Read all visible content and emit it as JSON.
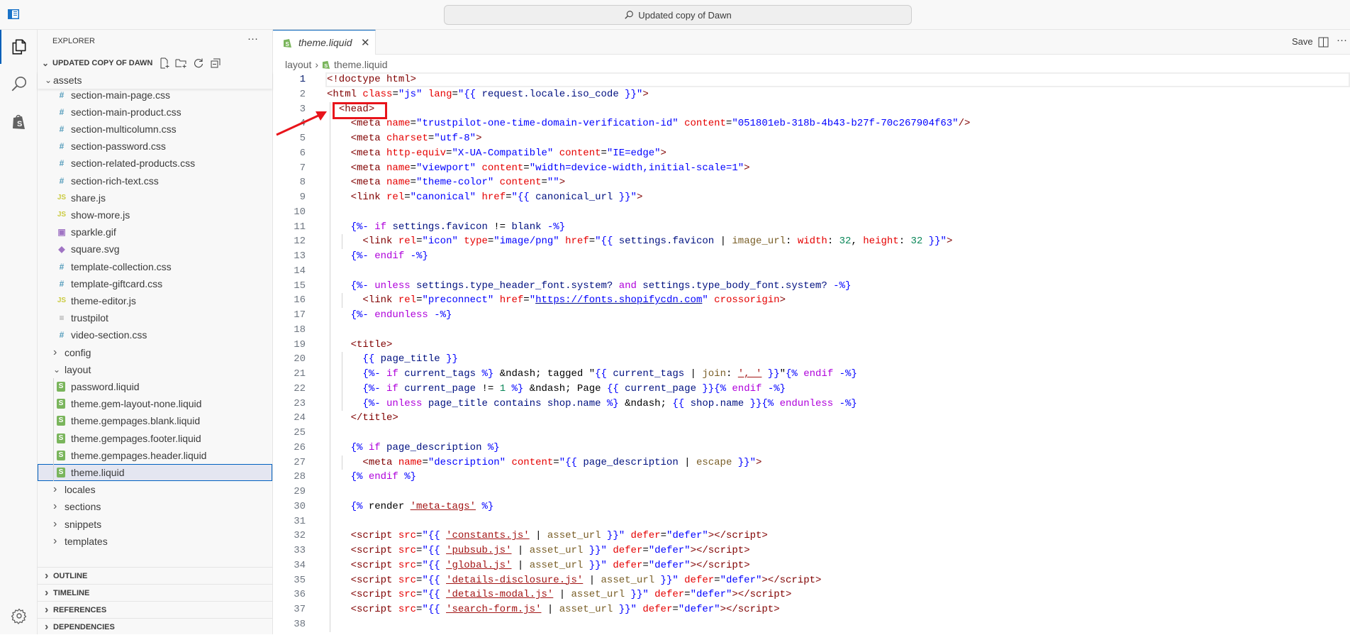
{
  "titlebar": {
    "search_text": "Updated copy of Dawn"
  },
  "activity": {
    "items": [
      "explorer",
      "search",
      "shopify"
    ],
    "settings": "settings"
  },
  "sidebar": {
    "title": "EXPLORER",
    "more": "···",
    "root": "UPDATED COPY OF DAWN",
    "assets_folder": "assets",
    "rows": [
      {
        "name": "section-main-page.css",
        "type": "css",
        "depth": 1
      },
      {
        "name": "section-main-product.css",
        "type": "css",
        "depth": 1
      },
      {
        "name": "section-multicolumn.css",
        "type": "css",
        "depth": 1
      },
      {
        "name": "section-password.css",
        "type": "css",
        "depth": 1
      },
      {
        "name": "section-related-products.css",
        "type": "css",
        "depth": 1
      },
      {
        "name": "section-rich-text.css",
        "type": "css",
        "depth": 1
      },
      {
        "name": "share.js",
        "type": "js",
        "depth": 1
      },
      {
        "name": "show-more.js",
        "type": "js",
        "depth": 1
      },
      {
        "name": "sparkle.gif",
        "type": "image",
        "depth": 1
      },
      {
        "name": "square.svg",
        "type": "svg",
        "depth": 1
      },
      {
        "name": "template-collection.css",
        "type": "css",
        "depth": 1
      },
      {
        "name": "template-giftcard.css",
        "type": "css",
        "depth": 1
      },
      {
        "name": "theme-editor.js",
        "type": "js",
        "depth": 1
      },
      {
        "name": "trustpilot",
        "type": "text",
        "depth": 1
      },
      {
        "name": "video-section.css",
        "type": "css",
        "depth": 1
      },
      {
        "name": "config",
        "type": "folder-closed",
        "depth": 0
      },
      {
        "name": "layout",
        "type": "folder-open",
        "depth": 0
      },
      {
        "name": "password.liquid",
        "type": "liquid",
        "depth": 1
      },
      {
        "name": "theme.gem-layout-none.liquid",
        "type": "liquid",
        "depth": 1
      },
      {
        "name": "theme.gempages.blank.liquid",
        "type": "liquid",
        "depth": 1
      },
      {
        "name": "theme.gempages.footer.liquid",
        "type": "liquid",
        "depth": 1
      },
      {
        "name": "theme.gempages.header.liquid",
        "type": "liquid",
        "depth": 1
      },
      {
        "name": "theme.liquid",
        "type": "liquid",
        "depth": 1,
        "selected": true
      },
      {
        "name": "locales",
        "type": "folder-closed",
        "depth": 0
      },
      {
        "name": "sections",
        "type": "folder-closed",
        "depth": 0
      },
      {
        "name": "snippets",
        "type": "folder-closed",
        "depth": 0
      },
      {
        "name": "templates",
        "type": "folder-closed",
        "depth": 0
      }
    ],
    "panels": [
      "OUTLINE",
      "TIMELINE",
      "REFERENCES",
      "DEPENDENCIES"
    ]
  },
  "editor": {
    "tab_label": "theme.liquid",
    "save_label": "Save",
    "breadcrumb": [
      "layout",
      "theme.liquid"
    ],
    "current_line": 1,
    "annotation_target": "<head>",
    "colors": {
      "tag": "#800000",
      "attr": "#e50000",
      "string": "#0000ff",
      "keyword": "#af00db",
      "variable": "#001080",
      "accent": "#005fb8",
      "annotation": "#e8141b"
    },
    "lines": [
      [
        [
          "t",
          "<!doctype html>"
        ]
      ],
      [
        [
          "t",
          "<html "
        ],
        [
          "a",
          "class"
        ],
        [
          "p",
          "="
        ],
        [
          "s",
          "\"js\" "
        ],
        [
          "a",
          "lang"
        ],
        [
          "p",
          "="
        ],
        [
          "s",
          "\"{{ "
        ],
        [
          "v",
          "request.locale.iso_code"
        ],
        [
          "s",
          " }}\""
        ],
        [
          "t",
          ">"
        ]
      ],
      [
        [
          "p",
          "  "
        ],
        [
          "t",
          "<head>"
        ]
      ],
      [
        [
          "p",
          "    "
        ],
        [
          "t",
          "<meta "
        ],
        [
          "a",
          "name"
        ],
        [
          "p",
          "="
        ],
        [
          "s",
          "\"trustpilot-one-time-domain-verification-id\" "
        ],
        [
          "a",
          "content"
        ],
        [
          "p",
          "="
        ],
        [
          "s",
          "\"051801eb-318b-4b43-b27f-70c267904f63\""
        ],
        [
          "t",
          "/>"
        ]
      ],
      [
        [
          "p",
          "    "
        ],
        [
          "t",
          "<meta "
        ],
        [
          "a",
          "charset"
        ],
        [
          "p",
          "="
        ],
        [
          "s",
          "\"utf-8\""
        ],
        [
          "t",
          ">"
        ]
      ],
      [
        [
          "p",
          "    "
        ],
        [
          "t",
          "<meta "
        ],
        [
          "a",
          "http-equiv"
        ],
        [
          "p",
          "="
        ],
        [
          "s",
          "\"X-UA-Compatible\" "
        ],
        [
          "a",
          "content"
        ],
        [
          "p",
          "="
        ],
        [
          "s",
          "\"IE=edge\""
        ],
        [
          "t",
          ">"
        ]
      ],
      [
        [
          "p",
          "    "
        ],
        [
          "t",
          "<meta "
        ],
        [
          "a",
          "name"
        ],
        [
          "p",
          "="
        ],
        [
          "s",
          "\"viewport\" "
        ],
        [
          "a",
          "content"
        ],
        [
          "p",
          "="
        ],
        [
          "s",
          "\"width=device-width,initial-scale=1\""
        ],
        [
          "t",
          ">"
        ]
      ],
      [
        [
          "p",
          "    "
        ],
        [
          "t",
          "<meta "
        ],
        [
          "a",
          "name"
        ],
        [
          "p",
          "="
        ],
        [
          "s",
          "\"theme-color\" "
        ],
        [
          "a",
          "content"
        ],
        [
          "p",
          "="
        ],
        [
          "s",
          "\"\""
        ],
        [
          "t",
          ">"
        ]
      ],
      [
        [
          "p",
          "    "
        ],
        [
          "t",
          "<link "
        ],
        [
          "a",
          "rel"
        ],
        [
          "p",
          "="
        ],
        [
          "s",
          "\"canonical\" "
        ],
        [
          "a",
          "href"
        ],
        [
          "p",
          "="
        ],
        [
          "s",
          "\"{{ "
        ],
        [
          "v",
          "canonical_url"
        ],
        [
          "s",
          " }}\""
        ],
        [
          "t",
          ">"
        ]
      ],
      [],
      [
        [
          "p",
          "    "
        ],
        [
          "d",
          "{%- "
        ],
        [
          "k",
          "if "
        ],
        [
          "v",
          "settings.favicon "
        ],
        [
          "p",
          "!= "
        ],
        [
          "v",
          "blank "
        ],
        [
          "d",
          "-%}"
        ]
      ],
      [
        [
          "p",
          "      "
        ],
        [
          "t",
          "<link "
        ],
        [
          "a",
          "rel"
        ],
        [
          "p",
          "="
        ],
        [
          "s",
          "\"icon\" "
        ],
        [
          "a",
          "type"
        ],
        [
          "p",
          "="
        ],
        [
          "s",
          "\"image/png\" "
        ],
        [
          "a",
          "href"
        ],
        [
          "p",
          "="
        ],
        [
          "s",
          "\"{{ "
        ],
        [
          "v",
          "settings.favicon "
        ],
        [
          "p",
          "| "
        ],
        [
          "f",
          "image_url"
        ],
        [
          "p",
          ": "
        ],
        [
          "a",
          "width"
        ],
        [
          "p",
          ": "
        ],
        [
          "n",
          "32"
        ],
        [
          "p",
          ", "
        ],
        [
          "a",
          "height"
        ],
        [
          "p",
          ": "
        ],
        [
          "n",
          "32"
        ],
        [
          "s",
          " }}\""
        ],
        [
          "t",
          ">"
        ]
      ],
      [
        [
          "p",
          "    "
        ],
        [
          "d",
          "{%- "
        ],
        [
          "k",
          "endif "
        ],
        [
          "d",
          "-%}"
        ]
      ],
      [],
      [
        [
          "p",
          "    "
        ],
        [
          "d",
          "{%- "
        ],
        [
          "k",
          "unless "
        ],
        [
          "v",
          "settings.type_header_font.system? "
        ],
        [
          "k",
          "and "
        ],
        [
          "v",
          "settings.type_body_font.system? "
        ],
        [
          "d",
          "-%}"
        ]
      ],
      [
        [
          "p",
          "      "
        ],
        [
          "t",
          "<link "
        ],
        [
          "a",
          "rel"
        ],
        [
          "p",
          "="
        ],
        [
          "s",
          "\"preconnect\" "
        ],
        [
          "a",
          "href"
        ],
        [
          "p",
          "="
        ],
        [
          "s",
          "\""
        ],
        [
          "u",
          "https://fonts.shopifycdn.com"
        ],
        [
          "s",
          "\" "
        ],
        [
          "a",
          "crossorigin"
        ],
        [
          "t",
          ">"
        ]
      ],
      [
        [
          "p",
          "    "
        ],
        [
          "d",
          "{%- "
        ],
        [
          "k",
          "endunless "
        ],
        [
          "d",
          "-%}"
        ]
      ],
      [],
      [
        [
          "p",
          "    "
        ],
        [
          "t",
          "<title>"
        ]
      ],
      [
        [
          "p",
          "      "
        ],
        [
          "d",
          "{{ "
        ],
        [
          "v",
          "page_title "
        ],
        [
          "d",
          "}}"
        ]
      ],
      [
        [
          "p",
          "      "
        ],
        [
          "d",
          "{%- "
        ],
        [
          "k",
          "if "
        ],
        [
          "v",
          "current_tags "
        ],
        [
          "d",
          "%} "
        ],
        [
          "p",
          "&ndash; tagged \""
        ],
        [
          "d",
          "{{ "
        ],
        [
          "v",
          "current_tags "
        ],
        [
          "p",
          "| "
        ],
        [
          "f",
          "join"
        ],
        [
          "p",
          ": "
        ],
        [
          "q",
          "', '"
        ],
        [
          "d",
          " }}"
        ],
        [
          "p",
          "\""
        ],
        [
          "d",
          "{% "
        ],
        [
          "k",
          "endif "
        ],
        [
          "d",
          "-%}"
        ]
      ],
      [
        [
          "p",
          "      "
        ],
        [
          "d",
          "{%- "
        ],
        [
          "k",
          "if "
        ],
        [
          "v",
          "current_page "
        ],
        [
          "p",
          "!= "
        ],
        [
          "n",
          "1 "
        ],
        [
          "d",
          "%} "
        ],
        [
          "p",
          "&ndash; Page "
        ],
        [
          "d",
          "{{ "
        ],
        [
          "v",
          "current_page "
        ],
        [
          "d",
          "}}{% "
        ],
        [
          "k",
          "endif "
        ],
        [
          "d",
          "-%}"
        ]
      ],
      [
        [
          "p",
          "      "
        ],
        [
          "d",
          "{%- "
        ],
        [
          "k",
          "unless "
        ],
        [
          "v",
          "page_title "
        ],
        [
          "v",
          "contains "
        ],
        [
          "v",
          "shop.name "
        ],
        [
          "d",
          "%} "
        ],
        [
          "p",
          "&ndash; "
        ],
        [
          "d",
          "{{ "
        ],
        [
          "v",
          "shop.name "
        ],
        [
          "d",
          "}}{% "
        ],
        [
          "k",
          "endunless "
        ],
        [
          "d",
          "-%}"
        ]
      ],
      [
        [
          "p",
          "    "
        ],
        [
          "t",
          "</title>"
        ]
      ],
      [],
      [
        [
          "p",
          "    "
        ],
        [
          "d",
          "{% "
        ],
        [
          "k",
          "if "
        ],
        [
          "v",
          "page_description "
        ],
        [
          "d",
          "%}"
        ]
      ],
      [
        [
          "p",
          "      "
        ],
        [
          "t",
          "<meta "
        ],
        [
          "a",
          "name"
        ],
        [
          "p",
          "="
        ],
        [
          "s",
          "\"description\" "
        ],
        [
          "a",
          "content"
        ],
        [
          "p",
          "="
        ],
        [
          "s",
          "\"{{ "
        ],
        [
          "v",
          "page_description "
        ],
        [
          "p",
          "| "
        ],
        [
          "f",
          "escape"
        ],
        [
          "s",
          " }}\""
        ],
        [
          "t",
          ">"
        ]
      ],
      [
        [
          "p",
          "    "
        ],
        [
          "d",
          "{% "
        ],
        [
          "k",
          "endif "
        ],
        [
          "d",
          "%}"
        ]
      ],
      [],
      [
        [
          "p",
          "    "
        ],
        [
          "d",
          "{% "
        ],
        [
          "p",
          "render "
        ],
        [
          "q",
          "'meta-tags'"
        ],
        [
          "d",
          " %}"
        ]
      ],
      [],
      [
        [
          "p",
          "    "
        ],
        [
          "t",
          "<script "
        ],
        [
          "a",
          "src"
        ],
        [
          "p",
          "="
        ],
        [
          "s",
          "\"{{ "
        ],
        [
          "q",
          "'constants.js'"
        ],
        [
          "p",
          " | "
        ],
        [
          "f",
          "asset_url"
        ],
        [
          "s",
          " }}\" "
        ],
        [
          "a",
          "defer"
        ],
        [
          "p",
          "="
        ],
        [
          "s",
          "\"defer\""
        ],
        [
          "t",
          "></script>"
        ]
      ],
      [
        [
          "p",
          "    "
        ],
        [
          "t",
          "<script "
        ],
        [
          "a",
          "src"
        ],
        [
          "p",
          "="
        ],
        [
          "s",
          "\"{{ "
        ],
        [
          "q",
          "'pubsub.js'"
        ],
        [
          "p",
          " | "
        ],
        [
          "f",
          "asset_url"
        ],
        [
          "s",
          " }}\" "
        ],
        [
          "a",
          "defer"
        ],
        [
          "p",
          "="
        ],
        [
          "s",
          "\"defer\""
        ],
        [
          "t",
          "></script>"
        ]
      ],
      [
        [
          "p",
          "    "
        ],
        [
          "t",
          "<script "
        ],
        [
          "a",
          "src"
        ],
        [
          "p",
          "="
        ],
        [
          "s",
          "\"{{ "
        ],
        [
          "q",
          "'global.js'"
        ],
        [
          "p",
          " | "
        ],
        [
          "f",
          "asset_url"
        ],
        [
          "s",
          " }}\" "
        ],
        [
          "a",
          "defer"
        ],
        [
          "p",
          "="
        ],
        [
          "s",
          "\"defer\""
        ],
        [
          "t",
          "></script>"
        ]
      ],
      [
        [
          "p",
          "    "
        ],
        [
          "t",
          "<script "
        ],
        [
          "a",
          "src"
        ],
        [
          "p",
          "="
        ],
        [
          "s",
          "\"{{ "
        ],
        [
          "q",
          "'details-disclosure.js'"
        ],
        [
          "p",
          " | "
        ],
        [
          "f",
          "asset_url"
        ],
        [
          "s",
          " }}\" "
        ],
        [
          "a",
          "defer"
        ],
        [
          "p",
          "="
        ],
        [
          "s",
          "\"defer\""
        ],
        [
          "t",
          "></script>"
        ]
      ],
      [
        [
          "p",
          "    "
        ],
        [
          "t",
          "<script "
        ],
        [
          "a",
          "src"
        ],
        [
          "p",
          "="
        ],
        [
          "s",
          "\"{{ "
        ],
        [
          "q",
          "'details-modal.js'"
        ],
        [
          "p",
          " | "
        ],
        [
          "f",
          "asset_url"
        ],
        [
          "s",
          " }}\" "
        ],
        [
          "a",
          "defer"
        ],
        [
          "p",
          "="
        ],
        [
          "s",
          "\"defer\""
        ],
        [
          "t",
          "></script>"
        ]
      ],
      [
        [
          "p",
          "    "
        ],
        [
          "t",
          "<script "
        ],
        [
          "a",
          "src"
        ],
        [
          "p",
          "="
        ],
        [
          "s",
          "\"{{ "
        ],
        [
          "q",
          "'search-form.js'"
        ],
        [
          "p",
          " | "
        ],
        [
          "f",
          "asset_url"
        ],
        [
          "s",
          " }}\" "
        ],
        [
          "a",
          "defer"
        ],
        [
          "p",
          "="
        ],
        [
          "s",
          "\"defer\""
        ],
        [
          "t",
          "></script>"
        ]
      ],
      []
    ]
  }
}
